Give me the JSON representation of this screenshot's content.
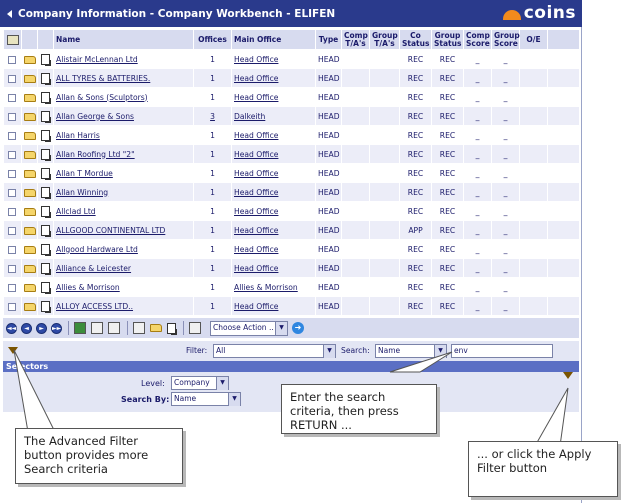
{
  "window": {
    "title": "Company Information - Company Workbench - ELIFEN",
    "logo_text": "coins"
  },
  "columns": [
    "Name",
    "Offices",
    "Main Office",
    "Type",
    "Comp T/A's",
    "Group T/A's",
    "Co Status",
    "Group Status",
    "Comp Score",
    "Group Score",
    "O/E"
  ],
  "rows": [
    {
      "name": "Alistair McLennan Ltd",
      "offices": "1",
      "main_office": "Head Office",
      "type": "HEAD",
      "co_status": "REC",
      "group_status": "REC",
      "comp_score": "_",
      "group_score": "_"
    },
    {
      "name": "ALL TYRES & BATTERIES.",
      "offices": "1",
      "main_office": "Head Office",
      "type": "HEAD",
      "co_status": "REC",
      "group_status": "REC",
      "comp_score": "_",
      "group_score": "_"
    },
    {
      "name": "Allan & Sons (Sculptors)",
      "offices": "1",
      "main_office": "Head Office",
      "type": "HEAD",
      "co_status": "REC",
      "group_status": "REC",
      "comp_score": "_",
      "group_score": "_"
    },
    {
      "name": "Allan George & Sons",
      "offices": "3",
      "main_office": "Dalkeith",
      "type": "HEAD",
      "co_status": "REC",
      "group_status": "REC",
      "comp_score": "_",
      "group_score": "_"
    },
    {
      "name": "Allan Harris",
      "offices": "1",
      "main_office": "Head Office",
      "type": "HEAD",
      "co_status": "REC",
      "group_status": "REC",
      "comp_score": "_",
      "group_score": "_"
    },
    {
      "name": "Allan Roofing Ltd \"2\"",
      "offices": "1",
      "main_office": "Head Office",
      "type": "HEAD",
      "co_status": "REC",
      "group_status": "REC",
      "comp_score": "_",
      "group_score": "_"
    },
    {
      "name": "Allan T Mordue",
      "offices": "1",
      "main_office": "Head Office",
      "type": "HEAD",
      "co_status": "REC",
      "group_status": "REC",
      "comp_score": "_",
      "group_score": "_"
    },
    {
      "name": "Allan Winning",
      "offices": "1",
      "main_office": "Head Office",
      "type": "HEAD",
      "co_status": "REC",
      "group_status": "REC",
      "comp_score": "_",
      "group_score": "_"
    },
    {
      "name": "Allclad Ltd",
      "offices": "1",
      "main_office": "Head Office",
      "type": "HEAD",
      "co_status": "REC",
      "group_status": "REC",
      "comp_score": "_",
      "group_score": "_"
    },
    {
      "name": "ALLGOOD CONTINENTAL LTD",
      "offices": "1",
      "main_office": "Head Office",
      "type": "HEAD",
      "co_status": "APP",
      "group_status": "REC",
      "comp_score": "_",
      "group_score": "_"
    },
    {
      "name": "Allgood Hardware Ltd",
      "offices": "1",
      "main_office": "Head Office",
      "type": "HEAD",
      "co_status": "REC",
      "group_status": "REC",
      "comp_score": "_",
      "group_score": "_"
    },
    {
      "name": "Alliance & Leicester",
      "offices": "1",
      "main_office": "Head Office",
      "type": "HEAD",
      "co_status": "REC",
      "group_status": "REC",
      "comp_score": "_",
      "group_score": "_"
    },
    {
      "name": "Allies & Morrison",
      "offices": "1",
      "main_office": "Allies & Morrison",
      "type": "HEAD",
      "co_status": "REC",
      "group_status": "REC",
      "comp_score": "_",
      "group_score": "_"
    },
    {
      "name": "ALLOY ACCESS LTD..",
      "offices": "1",
      "main_office": "Head Office",
      "type": "HEAD",
      "co_status": "REC",
      "group_status": "REC",
      "comp_score": "_",
      "group_score": "_"
    }
  ],
  "toolbar": {
    "action_select": "Choose Action ..",
    "nav_first": "◄◄",
    "nav_prev": "◄",
    "nav_next": "►",
    "nav_last": "►►",
    "go": "➜"
  },
  "filter": {
    "label": "Filter:",
    "value": "All",
    "search_label": "Search:",
    "search_by": "Name",
    "search_text": "env"
  },
  "selectors": {
    "title": "Selectors",
    "level_label": "Level:",
    "level_value": "Company",
    "search_by_label": "Search By:",
    "search_by_value": "Name"
  },
  "callouts": {
    "search": "Enter the search criteria, then press RETURN ...",
    "advanced": "The Advanced Filter button provides more Search criteria",
    "apply": "... or click the Apply Filter button"
  },
  "colors": {
    "titlebar": "#2a3a8c",
    "header": "#d7dbef",
    "accent_orange": "#f28a1c"
  }
}
